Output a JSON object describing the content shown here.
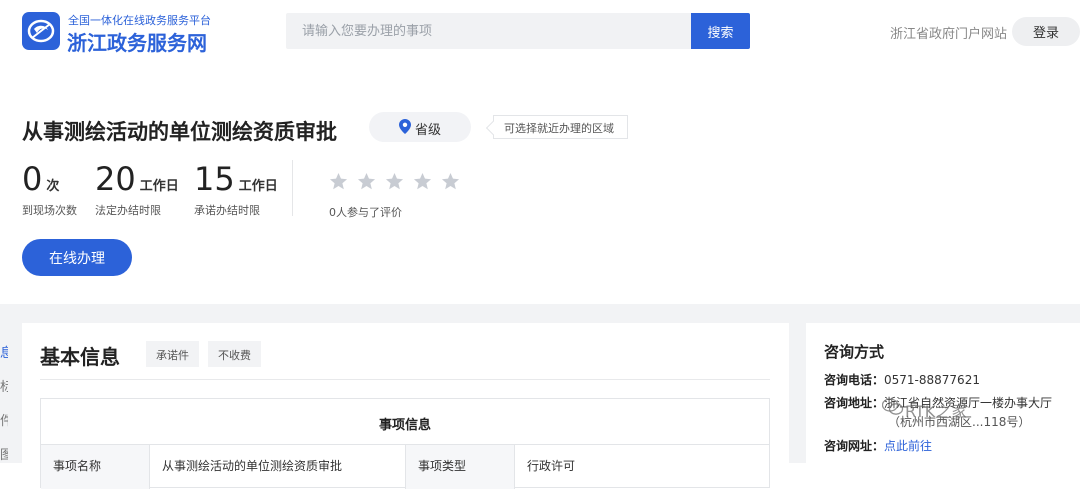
{
  "header": {
    "platform_subtitle": "全国一体化在线政务服务平台",
    "site_name": "浙江政务服务网",
    "search_placeholder": "请输入您要办理的事项",
    "search_button": "搜索",
    "portal_link": "浙江省政府门户网站",
    "login_button": "登录"
  },
  "item": {
    "title": "从事测绘活动的单位测绘资质审批",
    "level": "省级",
    "region_tip": "可选择就近办理的区域",
    "stats": [
      {
        "value": "0",
        "unit": "次",
        "caption": "到现场次数"
      },
      {
        "value": "20",
        "unit": "工作日",
        "caption": "法定办结时限"
      },
      {
        "value": "15",
        "unit": "工作日",
        "caption": "承诺办结时限"
      }
    ],
    "rating": 0,
    "rating_count_text": "0人参与了评价",
    "online_button": "在线办理"
  },
  "left_nav": [
    "息",
    "标",
    "件",
    "图"
  ],
  "basic_info": {
    "title": "基本信息",
    "tags": [
      "承诺件",
      "不收费"
    ],
    "table_title": "事项信息",
    "row": {
      "label1": "事项名称",
      "value1": "从事测绘活动的单位测绘资质审批",
      "label2": "事项类型",
      "value2": "行政许可"
    }
  },
  "consult": {
    "title": "咨询方式",
    "phone_label": "咨询电话：",
    "phone": "0571-88877621",
    "address_label": "咨询地址：",
    "address": "浙江省自然资源厅一楼办事大厅",
    "address_cont": "（杭州市西湖区...118号）",
    "url_label": "咨询网址：",
    "url_text": "点此前往"
  },
  "watermark": "RTK之家",
  "colors": {
    "accent": "#2c62d9",
    "star_inactive": "#c8ccd3",
    "background_band": "#f2f3f5"
  }
}
